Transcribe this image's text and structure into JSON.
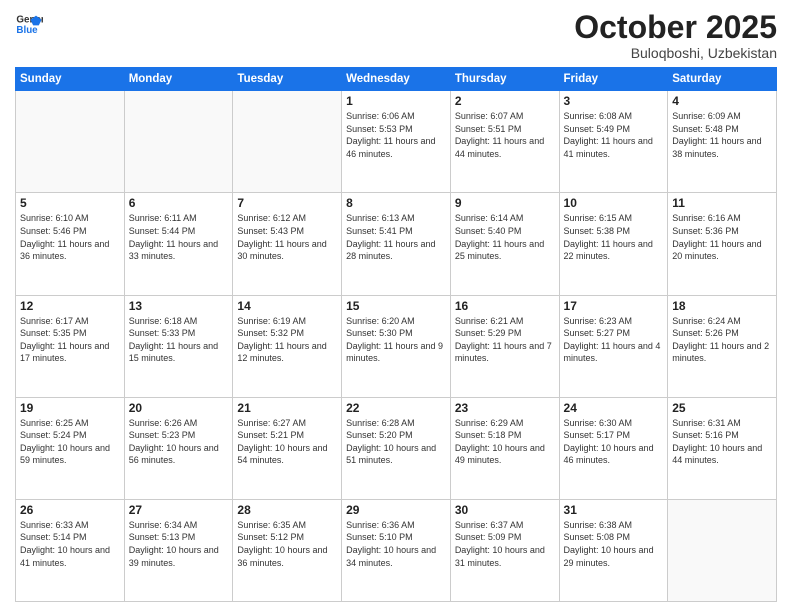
{
  "logo": {
    "line1": "General",
    "line2": "Blue"
  },
  "title": "October 2025",
  "subtitle": "Buloqboshi, Uzbekistan",
  "days_of_week": [
    "Sunday",
    "Monday",
    "Tuesday",
    "Wednesday",
    "Thursday",
    "Friday",
    "Saturday"
  ],
  "weeks": [
    [
      {
        "day": "",
        "info": ""
      },
      {
        "day": "",
        "info": ""
      },
      {
        "day": "",
        "info": ""
      },
      {
        "day": "1",
        "info": "Sunrise: 6:06 AM\nSunset: 5:53 PM\nDaylight: 11 hours and 46 minutes."
      },
      {
        "day": "2",
        "info": "Sunrise: 6:07 AM\nSunset: 5:51 PM\nDaylight: 11 hours and 44 minutes."
      },
      {
        "day": "3",
        "info": "Sunrise: 6:08 AM\nSunset: 5:49 PM\nDaylight: 11 hours and 41 minutes."
      },
      {
        "day": "4",
        "info": "Sunrise: 6:09 AM\nSunset: 5:48 PM\nDaylight: 11 hours and 38 minutes."
      }
    ],
    [
      {
        "day": "5",
        "info": "Sunrise: 6:10 AM\nSunset: 5:46 PM\nDaylight: 11 hours and 36 minutes."
      },
      {
        "day": "6",
        "info": "Sunrise: 6:11 AM\nSunset: 5:44 PM\nDaylight: 11 hours and 33 minutes."
      },
      {
        "day": "7",
        "info": "Sunrise: 6:12 AM\nSunset: 5:43 PM\nDaylight: 11 hours and 30 minutes."
      },
      {
        "day": "8",
        "info": "Sunrise: 6:13 AM\nSunset: 5:41 PM\nDaylight: 11 hours and 28 minutes."
      },
      {
        "day": "9",
        "info": "Sunrise: 6:14 AM\nSunset: 5:40 PM\nDaylight: 11 hours and 25 minutes."
      },
      {
        "day": "10",
        "info": "Sunrise: 6:15 AM\nSunset: 5:38 PM\nDaylight: 11 hours and 22 minutes."
      },
      {
        "day": "11",
        "info": "Sunrise: 6:16 AM\nSunset: 5:36 PM\nDaylight: 11 hours and 20 minutes."
      }
    ],
    [
      {
        "day": "12",
        "info": "Sunrise: 6:17 AM\nSunset: 5:35 PM\nDaylight: 11 hours and 17 minutes."
      },
      {
        "day": "13",
        "info": "Sunrise: 6:18 AM\nSunset: 5:33 PM\nDaylight: 11 hours and 15 minutes."
      },
      {
        "day": "14",
        "info": "Sunrise: 6:19 AM\nSunset: 5:32 PM\nDaylight: 11 hours and 12 minutes."
      },
      {
        "day": "15",
        "info": "Sunrise: 6:20 AM\nSunset: 5:30 PM\nDaylight: 11 hours and 9 minutes."
      },
      {
        "day": "16",
        "info": "Sunrise: 6:21 AM\nSunset: 5:29 PM\nDaylight: 11 hours and 7 minutes."
      },
      {
        "day": "17",
        "info": "Sunrise: 6:23 AM\nSunset: 5:27 PM\nDaylight: 11 hours and 4 minutes."
      },
      {
        "day": "18",
        "info": "Sunrise: 6:24 AM\nSunset: 5:26 PM\nDaylight: 11 hours and 2 minutes."
      }
    ],
    [
      {
        "day": "19",
        "info": "Sunrise: 6:25 AM\nSunset: 5:24 PM\nDaylight: 10 hours and 59 minutes."
      },
      {
        "day": "20",
        "info": "Sunrise: 6:26 AM\nSunset: 5:23 PM\nDaylight: 10 hours and 56 minutes."
      },
      {
        "day": "21",
        "info": "Sunrise: 6:27 AM\nSunset: 5:21 PM\nDaylight: 10 hours and 54 minutes."
      },
      {
        "day": "22",
        "info": "Sunrise: 6:28 AM\nSunset: 5:20 PM\nDaylight: 10 hours and 51 minutes."
      },
      {
        "day": "23",
        "info": "Sunrise: 6:29 AM\nSunset: 5:18 PM\nDaylight: 10 hours and 49 minutes."
      },
      {
        "day": "24",
        "info": "Sunrise: 6:30 AM\nSunset: 5:17 PM\nDaylight: 10 hours and 46 minutes."
      },
      {
        "day": "25",
        "info": "Sunrise: 6:31 AM\nSunset: 5:16 PM\nDaylight: 10 hours and 44 minutes."
      }
    ],
    [
      {
        "day": "26",
        "info": "Sunrise: 6:33 AM\nSunset: 5:14 PM\nDaylight: 10 hours and 41 minutes."
      },
      {
        "day": "27",
        "info": "Sunrise: 6:34 AM\nSunset: 5:13 PM\nDaylight: 10 hours and 39 minutes."
      },
      {
        "day": "28",
        "info": "Sunrise: 6:35 AM\nSunset: 5:12 PM\nDaylight: 10 hours and 36 minutes."
      },
      {
        "day": "29",
        "info": "Sunrise: 6:36 AM\nSunset: 5:10 PM\nDaylight: 10 hours and 34 minutes."
      },
      {
        "day": "30",
        "info": "Sunrise: 6:37 AM\nSunset: 5:09 PM\nDaylight: 10 hours and 31 minutes."
      },
      {
        "day": "31",
        "info": "Sunrise: 6:38 AM\nSunset: 5:08 PM\nDaylight: 10 hours and 29 minutes."
      },
      {
        "day": "",
        "info": ""
      }
    ]
  ]
}
